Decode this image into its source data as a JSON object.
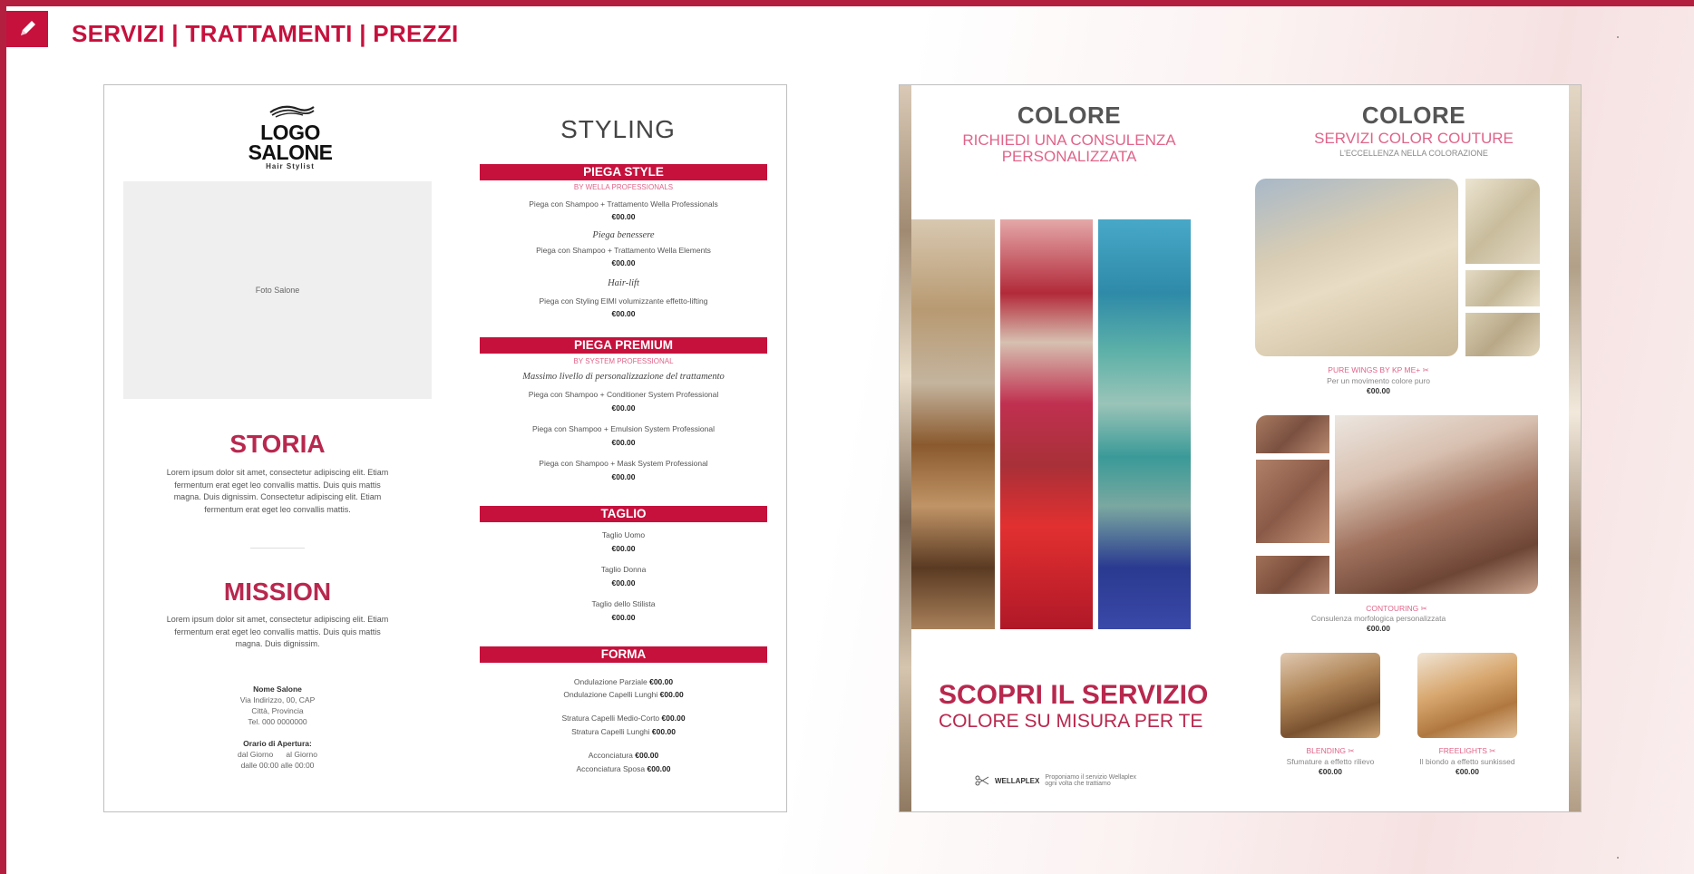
{
  "header": {
    "title": "SERVIZI | TRATTAMENTI | PREZZI"
  },
  "accent_color": "#c6113d",
  "left_page": {
    "logo": {
      "main": "LOGO SALONE",
      "sub": "Hair Stylist"
    },
    "photo_placeholder": "Foto Salone",
    "storia": {
      "title": "STORIA",
      "text": "Lorem ipsum dolor sit amet, consectetur adipiscing elit. Etiam fermentum erat eget leo convallis mattis. Duis quis mattis magna. Duis dignissim. Consectetur adipiscing elit. Etiam fermentum erat eget leo convallis mattis."
    },
    "mission": {
      "title": "MISSION",
      "text": "Lorem ipsum dolor sit amet, consectetur adipiscing elit. Etiam fermentum erat eget leo convallis mattis. Duis quis mattis magna. Duis dignissim."
    },
    "contact": {
      "name": "Nome Salone",
      "address": "Via Indirizzo, 00, CAP",
      "city": "Città, Provincia",
      "tel": "Tel. 000 0000000"
    },
    "hours": {
      "label": "Orario di Apertura:",
      "days": "dal Giorno      al Giorno",
      "time": "dalle 00:00 alle 00:00"
    },
    "styling_title": "STYLING",
    "piega_style": {
      "bar": "PIEGA STYLE",
      "sub": "BY WELLA PROFESSIONALS",
      "items": [
        {
          "line": "Piega con Shampoo + Trattamento Wella Professionals",
          "price": "€00.00"
        },
        {
          "italic": "Piega benessere",
          "line": "Piega con Shampoo + Trattamento Wella Elements",
          "price": "€00.00"
        },
        {
          "italic": "Hair-lift",
          "line": "Piega con Styling EIMI volumizzante effetto-lifting",
          "price": "€00.00"
        }
      ]
    },
    "piega_premium": {
      "bar": "PIEGA PREMIUM",
      "sub": "BY SYSTEM PROFESSIONAL",
      "italic": "Massimo livello di personalizzazione del trattamento",
      "items": [
        {
          "line": "Piega con Shampoo + Conditioner System Professional",
          "price": "€00.00"
        },
        {
          "line": "Piega con Shampoo + Emulsion System Professional",
          "price": "€00.00"
        },
        {
          "line": "Piega con Shampoo + Mask System Professional",
          "price": "€00.00"
        }
      ]
    },
    "taglio": {
      "bar": "TAGLIO",
      "items": [
        {
          "line": "Taglio Uomo",
          "price": "€00.00"
        },
        {
          "line": "Taglio Donna",
          "price": "€00.00"
        },
        {
          "line": "Taglio dello Stilista",
          "price": "€00.00"
        }
      ]
    },
    "forma": {
      "bar": "FORMA",
      "items": [
        {
          "label": "Ondulazione Parziale",
          "price": "€00.00"
        },
        {
          "label": "Ondulazione Capelli Lunghi",
          "price": "€00.00"
        },
        {
          "label": "Stratura Capelli Medio-Corto",
          "price": "€00.00"
        },
        {
          "label": "Stratura Capelli Lunghi",
          "price": "€00.00"
        },
        {
          "label": "Acconciatura",
          "price": "€00.00"
        },
        {
          "label": "Acconciatura Sposa",
          "price": "€00.00"
        }
      ]
    }
  },
  "right_page": {
    "left_col": {
      "title": "COLORE",
      "subtitle": "RICHIEDI UNA CONSULENZA PERSONALIZZATA",
      "cta_title": "SCOPRI IL SERVIZIO",
      "cta_sub": "COLORE SU MISURA PER TE",
      "logos": {
        "brand": "WELLAPLEX",
        "note": "Proponiamo il servizio Wellaplex ogni volta che trattiamo"
      }
    },
    "right_col": {
      "title": "COLORE",
      "subtitle": "SERVIZI COLOR COUTURE",
      "small": "L'ECCELLENZA NELLA COLORAZIONE",
      "services": [
        {
          "name": "PURE WINGS BY KP ME+",
          "desc": "Per un movimento colore puro",
          "price": "€00.00"
        },
        {
          "name": "CONTOURING",
          "desc": "Consulenza morfologica personalizzata",
          "price": "€00.00"
        },
        {
          "name": "BLENDING",
          "desc": "Sfumature a effetto rilievo",
          "price": "€00.00"
        },
        {
          "name": "FREELIGHTS",
          "desc": "Il biondo a effetto sunkissed",
          "price": "€00.00"
        }
      ]
    }
  }
}
